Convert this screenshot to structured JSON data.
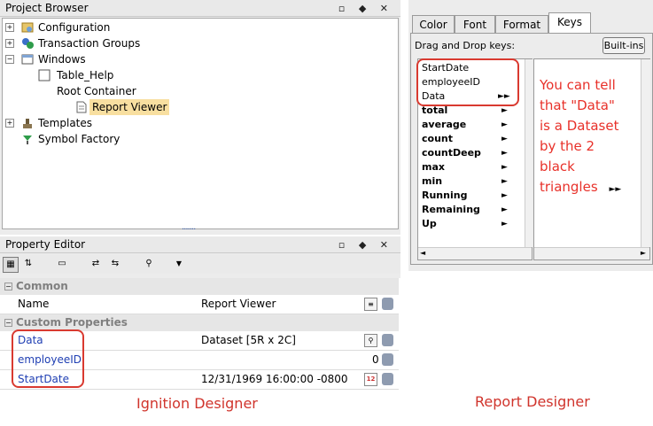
{
  "project_browser": {
    "title": "Project Browser",
    "items": [
      {
        "label": "Configuration"
      },
      {
        "label": "Transaction Groups"
      },
      {
        "label": "Windows"
      },
      {
        "label": "Table_Help"
      },
      {
        "label": "Root Container"
      },
      {
        "label": "Report Viewer"
      },
      {
        "label": "Templates"
      },
      {
        "label": "Symbol Factory"
      }
    ],
    "grip": "......."
  },
  "property_editor": {
    "title": "Property Editor",
    "sections": {
      "common": "Common",
      "custom": "Custom Properties"
    },
    "rows": [
      {
        "name": "Name",
        "value": "Report Viewer"
      },
      {
        "name": "Data",
        "value": "Dataset [5R x 2C]"
      },
      {
        "name": "employeeID",
        "value": "0"
      },
      {
        "name": "StartDate",
        "value": "12/31/1969 16:00:00 -0800"
      }
    ]
  },
  "report_designer": {
    "tabs": [
      "Color",
      "Font",
      "Format",
      "Keys"
    ],
    "active_tab": "Keys",
    "drag_label": "Drag and Drop keys:",
    "builtins_label": "Built-ins",
    "keys": [
      {
        "name": "StartDate",
        "arrow": ""
      },
      {
        "name": "employeeID",
        "arrow": ""
      },
      {
        "name": "Data",
        "arrow": "►►"
      },
      {
        "name": "total",
        "arrow": "►"
      },
      {
        "name": "average",
        "arrow": "►"
      },
      {
        "name": "count",
        "arrow": "►"
      },
      {
        "name": "countDeep",
        "arrow": "►"
      },
      {
        "name": "max",
        "arrow": "►"
      },
      {
        "name": "min",
        "arrow": "►"
      },
      {
        "name": "Running",
        "arrow": "►"
      },
      {
        "name": "Remaining",
        "arrow": "►"
      },
      {
        "name": "Up",
        "arrow": "►"
      }
    ],
    "note_lines": [
      "You can tell",
      "that \"Data\"",
      "is a Dataset",
      "by the 2",
      "black",
      "triangles"
    ],
    "note_arrow": "►►"
  },
  "captions": {
    "left": "Ignition Designer",
    "right": "Report Designer"
  },
  "title_buttons": "▫ ◆ ✕"
}
